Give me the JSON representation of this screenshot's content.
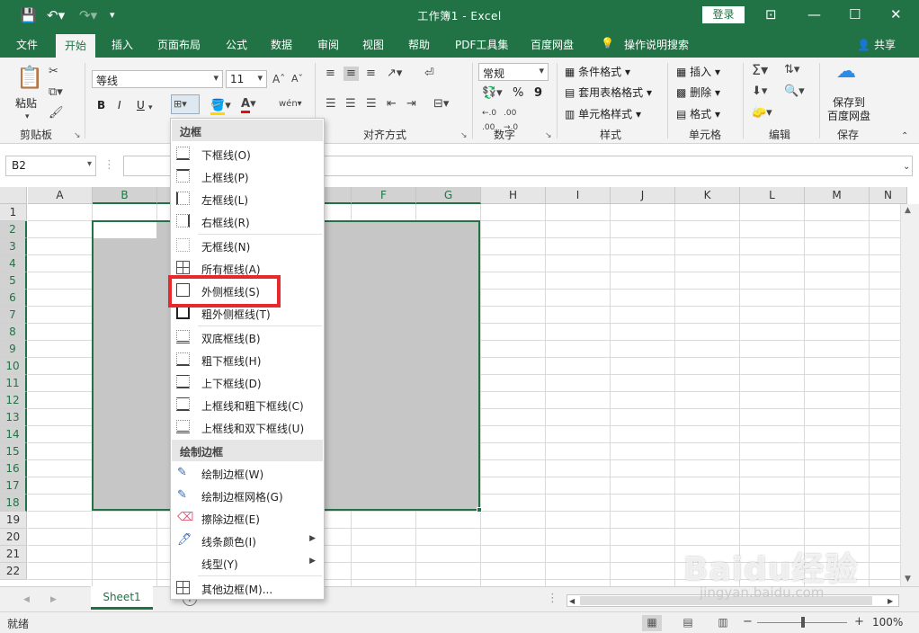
{
  "window": {
    "title": "工作簿1  -  Excel",
    "login": "登录"
  },
  "ribbon_tabs": [
    "文件",
    "开始",
    "插入",
    "页面布局",
    "公式",
    "数据",
    "审阅",
    "视图",
    "帮助",
    "PDF工具集",
    "百度网盘"
  ],
  "tell_me": "操作说明搜索",
  "share": "共享",
  "clipboard": {
    "paste": "粘贴",
    "label": "剪贴板"
  },
  "font": {
    "name": "等线",
    "size": "11",
    "bold": "B",
    "italic": "I",
    "underline": "U",
    "color_a": "A"
  },
  "alignment": {
    "label": "对齐方式"
  },
  "number": {
    "format": "常规",
    "percent": "%",
    "comma": "9",
    "label": "数字"
  },
  "styles": {
    "conditional": "条件格式",
    "table": "套用表格格式",
    "cell": "单元格样式",
    "label": "样式"
  },
  "cells": {
    "insert": "插入",
    "delete": "删除",
    "format": "格式",
    "label": "单元格"
  },
  "editing": {
    "label": "编辑"
  },
  "save": {
    "line1": "保存到",
    "line2": "百度网盘",
    "label": "保存"
  },
  "name_box": "B2",
  "columns": [
    "A",
    "B",
    "C",
    "D",
    "E",
    "F",
    "G",
    "H",
    "I",
    "J",
    "K",
    "L",
    "M",
    "N"
  ],
  "rows": [
    "1",
    "2",
    "3",
    "4",
    "5",
    "6",
    "7",
    "8",
    "9",
    "10",
    "11",
    "12",
    "13",
    "14",
    "15",
    "16",
    "17",
    "18",
    "19",
    "20",
    "21",
    "22"
  ],
  "sheet_tab": "Sheet1",
  "status": {
    "ready": "就绪",
    "zoom": "100%"
  },
  "menu": {
    "header1": "边框",
    "items1": [
      {
        "label": "下框线(O)",
        "icon": "bottom"
      },
      {
        "label": "上框线(P)",
        "icon": "top"
      },
      {
        "label": "左框线(L)",
        "icon": "left"
      },
      {
        "label": "右框线(R)",
        "icon": "right"
      }
    ],
    "items2": [
      {
        "label": "无框线(N)",
        "icon": "none"
      },
      {
        "label": "所有框线(A)",
        "icon": "solid"
      },
      {
        "label": "外侧框线(S)",
        "icon": "outside"
      },
      {
        "label": "粗外侧框线(T)",
        "icon": "thick"
      }
    ],
    "items3": [
      {
        "label": "双底框线(B)",
        "icon": "dbl"
      },
      {
        "label": "粗下框线(H)",
        "icon": "bottom"
      },
      {
        "label": "上下框线(D)",
        "icon": "tb"
      },
      {
        "label": "上框线和粗下框线(C)",
        "icon": "tb"
      },
      {
        "label": "上框线和双下框线(U)",
        "icon": "dbl"
      }
    ],
    "header2": "绘制边框",
    "items4": [
      {
        "label": "绘制边框(W)"
      },
      {
        "label": "绘制边框网格(G)"
      },
      {
        "label": "擦除边框(E)"
      },
      {
        "label": "线条颜色(I)"
      },
      {
        "label": "线型(Y)"
      }
    ],
    "more": "其他边框(M)..."
  },
  "watermark": {
    "brand": "Baidu经验",
    "url": "jingyan.baidu.com"
  },
  "colors": {
    "accent": "#217346",
    "highlight": "#e8282a",
    "selection": "#c6c6c6"
  }
}
